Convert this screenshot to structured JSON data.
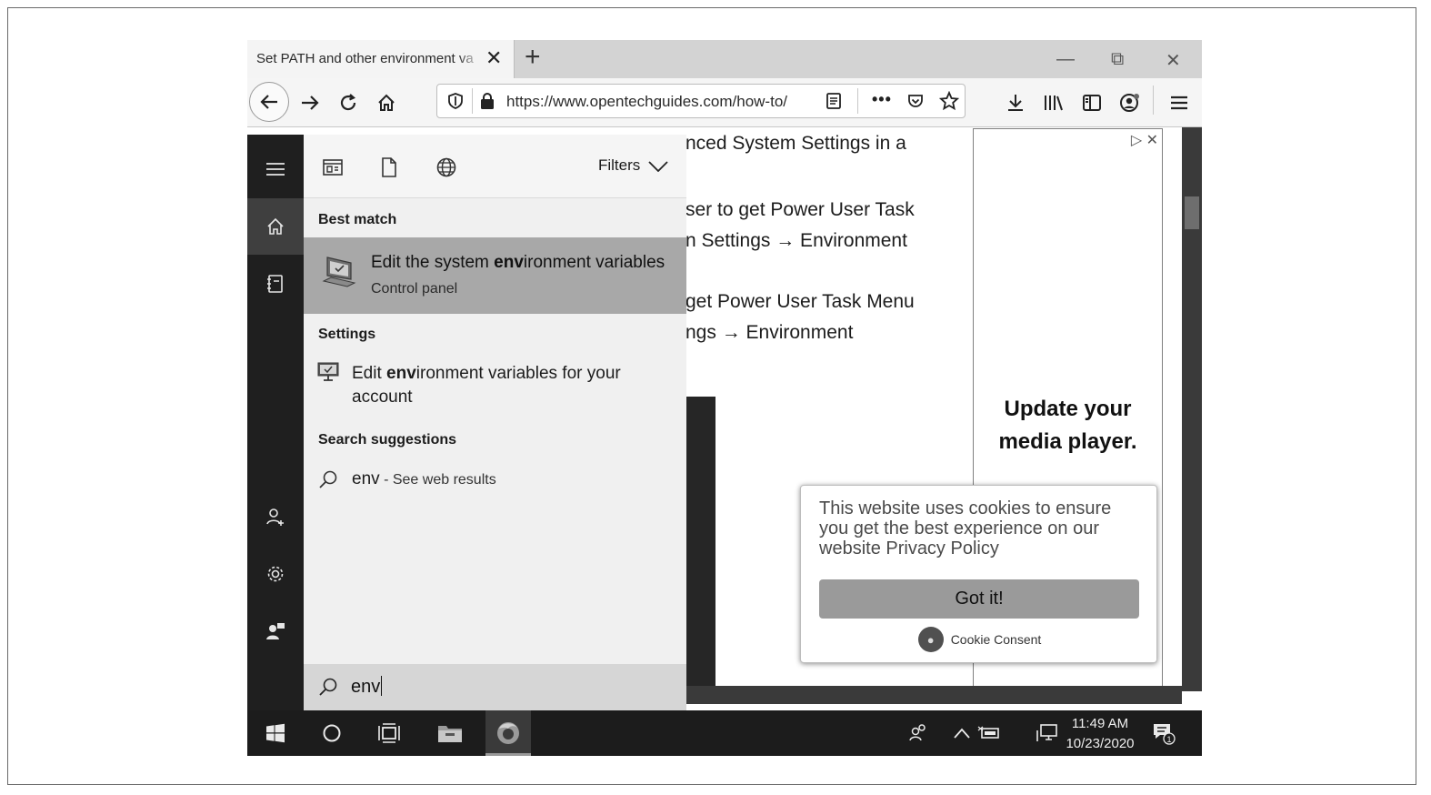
{
  "browser": {
    "tab_title": "Set PATH and other environment va",
    "url": "https://www.opentechguides.com/how-to/",
    "window_controls": {
      "minimize": "—",
      "restore": "⧉",
      "close": "✕"
    }
  },
  "article": {
    "lines": [
      "nced System Settings in a",
      "ser to get Power User Task",
      "n Settings → Environment",
      "get Power User Task Menu",
      "ngs → Environment"
    ]
  },
  "ad": {
    "text": "Update your media player."
  },
  "cookie": {
    "message": "This website uses cookies to ensure you get the best experience on our website Privacy Policy",
    "button": "Got it!",
    "brand": "Cookie Consent"
  },
  "search": {
    "filters_label": "Filters",
    "best_match_heading": "Best match",
    "best_match": {
      "title_pre": "Edit the system ",
      "title_bold": "env",
      "title_post": "ironment variables",
      "subtitle": "Control panel"
    },
    "settings_heading": "Settings",
    "settings_item": {
      "pre": "Edit ",
      "bold": "env",
      "post": "ironment variables for your account"
    },
    "suggestions_heading": "Search suggestions",
    "suggestion": {
      "query": "env",
      "suffix": " - See web results"
    },
    "query": "env"
  },
  "taskbar": {
    "time": "11:49 AM",
    "date": "10/23/2020",
    "notification_count": "1"
  }
}
